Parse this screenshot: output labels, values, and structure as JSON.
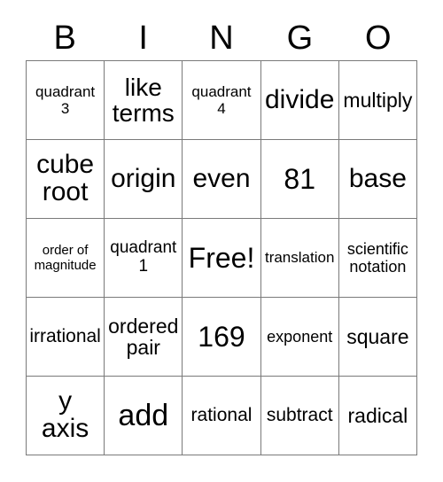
{
  "card": {
    "title": "BINGO",
    "headers": [
      "B",
      "I",
      "N",
      "G",
      "O"
    ],
    "free_space_label": "Free!",
    "border_color": "#7a7a7a",
    "text_color": "#000000",
    "background_color": "#ffffff",
    "rows": [
      [
        {
          "text": "quadrant\n3",
          "size": "fs-s"
        },
        {
          "text": "like\nterms",
          "size": "fs-2xl"
        },
        {
          "text": "quadrant\n4",
          "size": "fs-s"
        },
        {
          "text": "divide",
          "size": "fs-3xl"
        },
        {
          "text": "multiply",
          "size": "fs-l"
        }
      ],
      [
        {
          "text": "cube\nroot",
          "size": "fs-3xl"
        },
        {
          "text": "origin",
          "size": "fs-3xl"
        },
        {
          "text": "even",
          "size": "fs-3xl"
        },
        {
          "text": "81",
          "size": "fs-4xl"
        },
        {
          "text": "base",
          "size": "fs-3xl"
        }
      ],
      [
        {
          "text": "order of\nmagnitude",
          "size": "fs-xs"
        },
        {
          "text": "quadrant\n1",
          "size": "fs-m"
        },
        {
          "text": "Free!",
          "size": "fs-4xl"
        },
        {
          "text": "translation",
          "size": "fs-s"
        },
        {
          "text": "scientific\nnotation",
          "size": "fs-sm"
        }
      ],
      [
        {
          "text": "irrational",
          "size": "fs-ml"
        },
        {
          "text": "ordered\npair",
          "size": "fs-l"
        },
        {
          "text": "169",
          "size": "fs-4xl"
        },
        {
          "text": "exponent",
          "size": "fs-sm"
        },
        {
          "text": "square",
          "size": "fs-l"
        }
      ],
      [
        {
          "text": "y\naxis",
          "size": "fs-3xl"
        },
        {
          "text": "add",
          "size": "fs-5xl"
        },
        {
          "text": "rational",
          "size": "fs-ml"
        },
        {
          "text": "subtract",
          "size": "fs-ml"
        },
        {
          "text": "radical",
          "size": "fs-l"
        }
      ]
    ]
  }
}
